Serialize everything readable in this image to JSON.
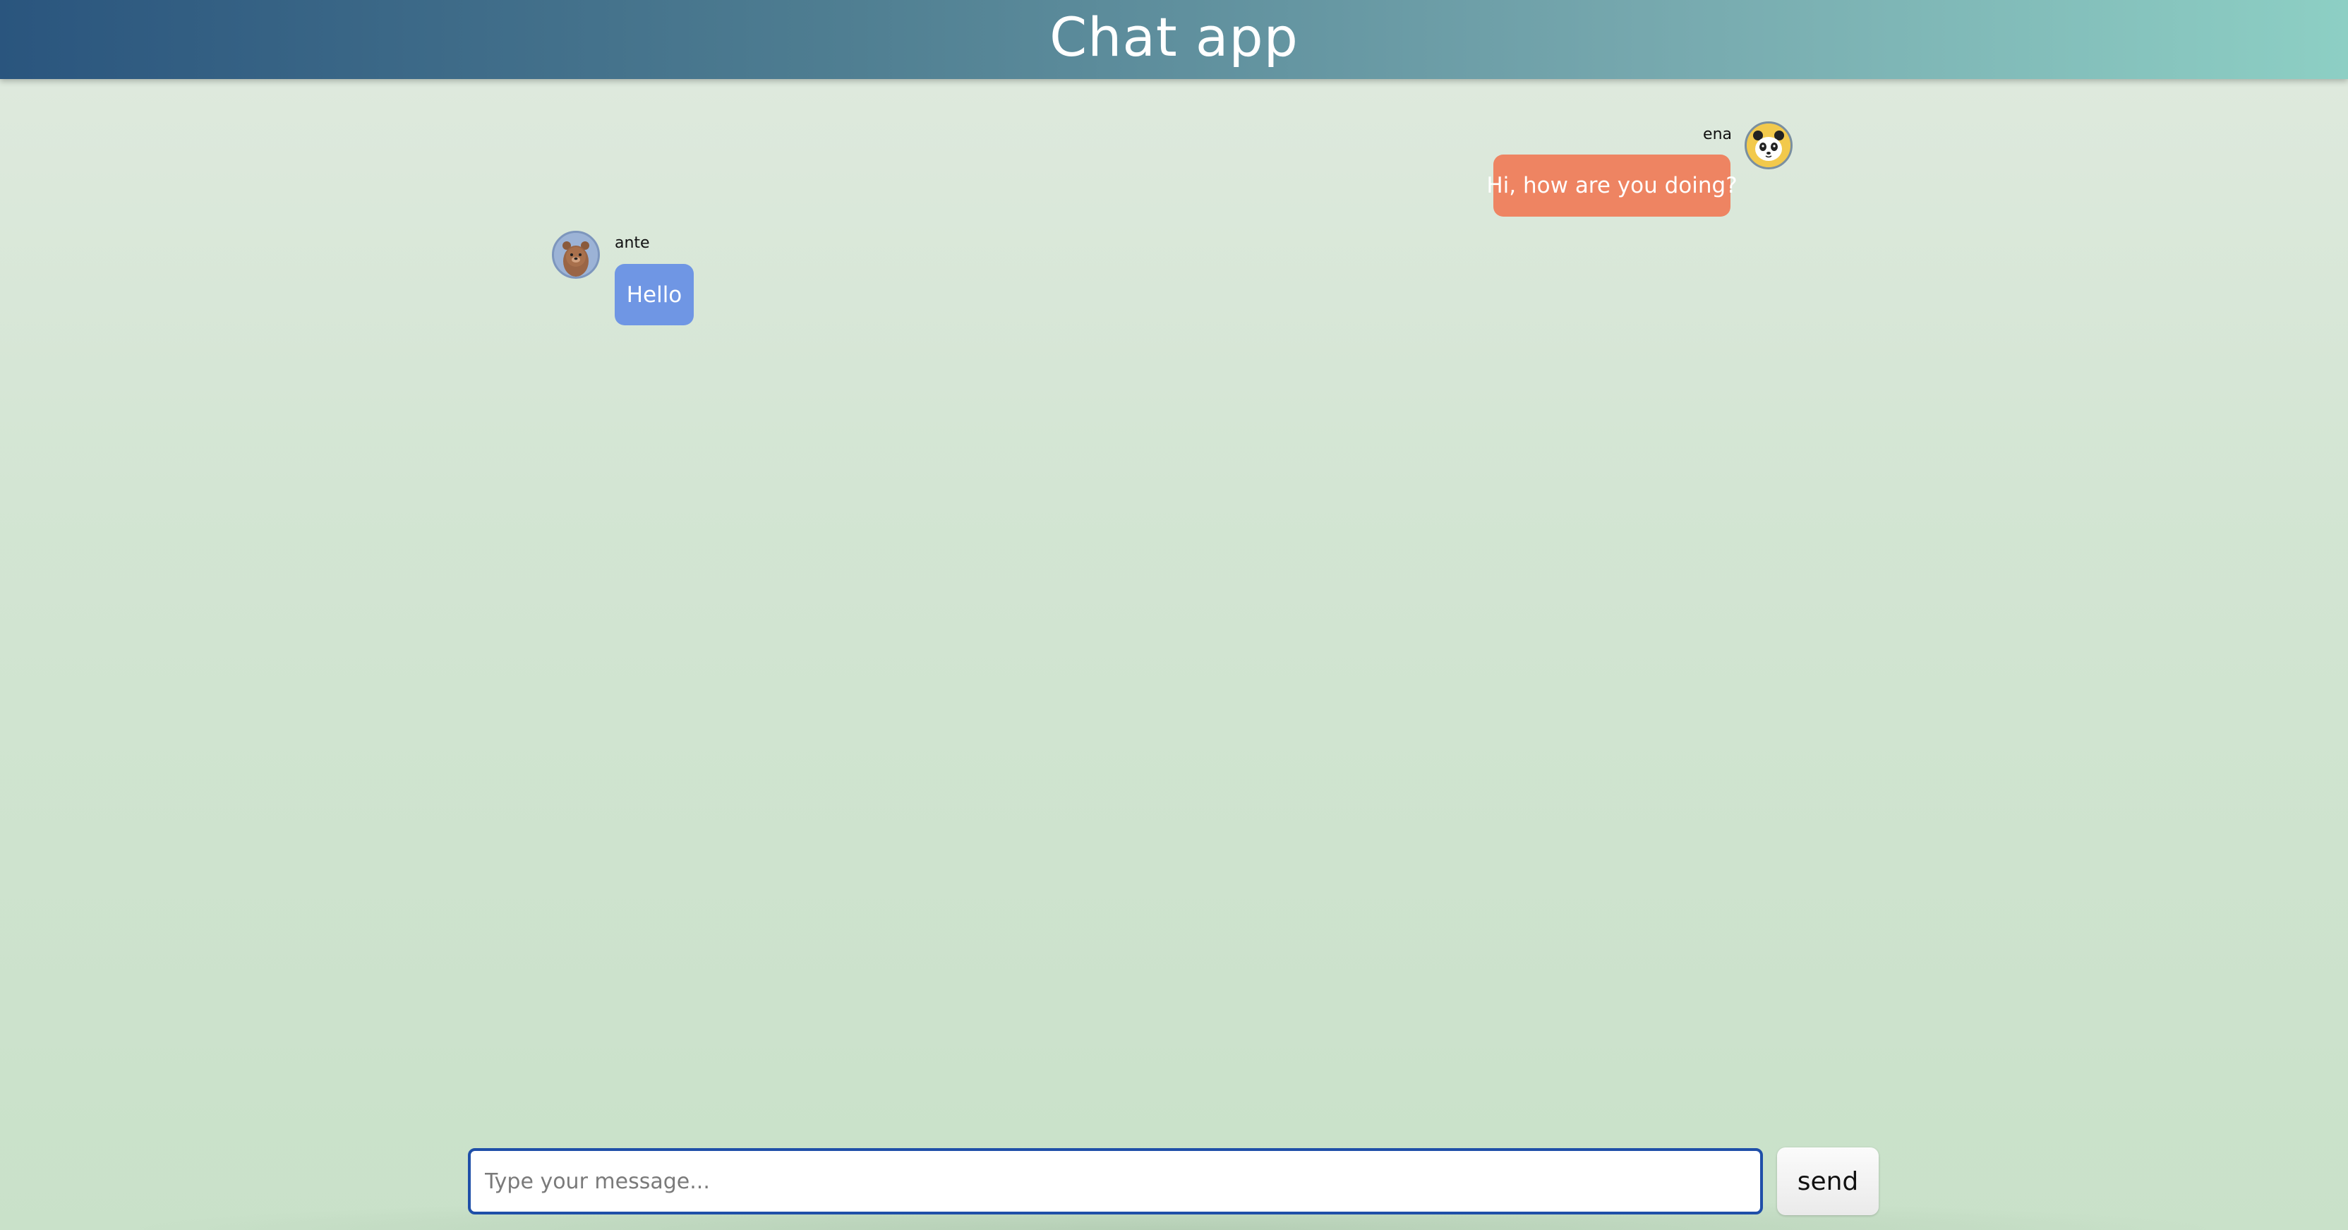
{
  "header": {
    "title": "Chat app"
  },
  "messages": [
    {
      "sender": "ena",
      "text": "Hi, how are you doing?",
      "side": "right",
      "bubble_color": "#ee8462",
      "avatar_icon": "panda-avatar"
    },
    {
      "sender": "ante",
      "text": "Hello",
      "side": "left",
      "bubble_color": "#6f96e4",
      "avatar_icon": "bear-avatar"
    }
  ],
  "composer": {
    "placeholder": "Type your message...",
    "value": "",
    "send_label": "send"
  },
  "colors": {
    "header_gradient_start": "#2a557e",
    "header_gradient_end": "#8dcfc4",
    "background": "#d3e5d3",
    "input_border": "#1f4fa8"
  }
}
